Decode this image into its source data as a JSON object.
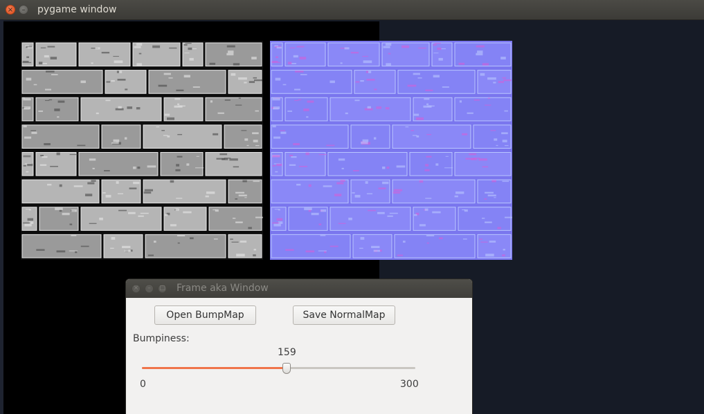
{
  "window": {
    "title": "pygame window"
  },
  "textures": {
    "bump": {
      "kind": "grayscale-brick-bump-map"
    },
    "normal": {
      "kind": "blue-brick-normal-map"
    }
  },
  "dialog": {
    "title": "Frame aka Window",
    "open_button": "Open BumpMap",
    "save_button": "Save NormalMap",
    "bumpiness_label": "Bumpiness:",
    "slider": {
      "value": "159",
      "min": "0",
      "max": "300",
      "fraction": 0.53
    },
    "accent_color": "#f0744a"
  },
  "colors": {
    "bump_mortar": "#111111",
    "normal_base": "#8584f7"
  }
}
